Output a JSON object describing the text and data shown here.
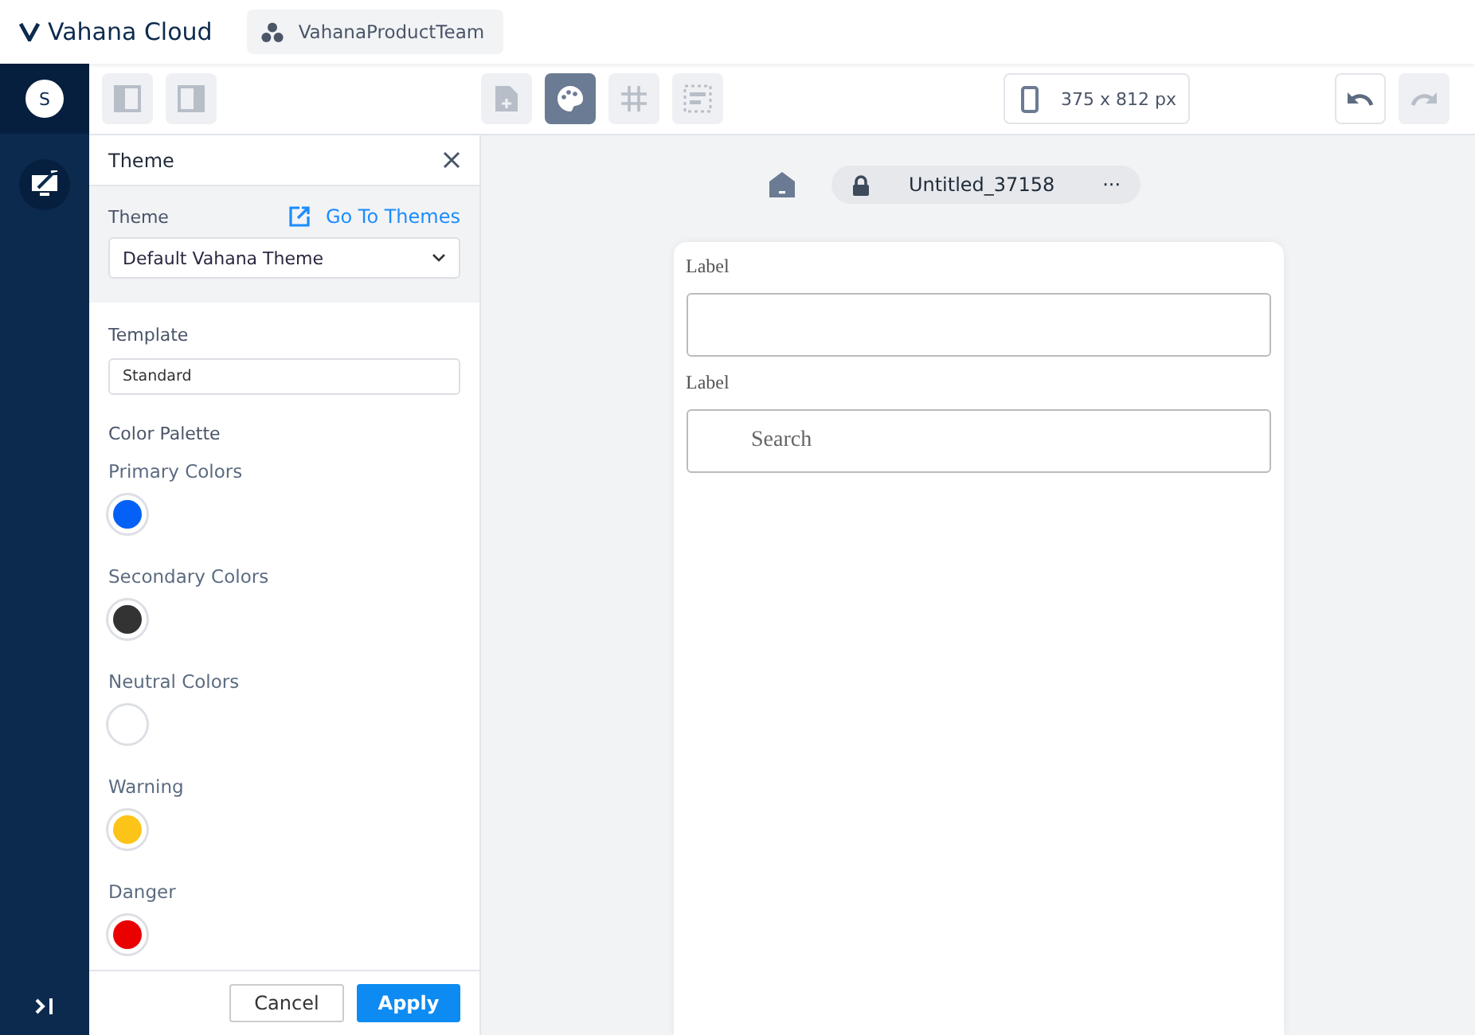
{
  "app": {
    "name": "Vahana Cloud",
    "team": "VahanaProductTeam",
    "avatar": "S"
  },
  "layout_buttons": [
    {
      "kind": "left",
      "selected": false
    },
    {
      "kind": "right",
      "selected": false
    }
  ],
  "tools": [
    {
      "kind": "page",
      "selected": false
    },
    {
      "kind": "palette",
      "selected": true
    },
    {
      "kind": "grid",
      "selected": false
    },
    {
      "kind": "layout",
      "selected": false
    }
  ],
  "device": {
    "size": "375 x 812 px"
  },
  "history": [
    {
      "kind": "undo",
      "disabled": false
    },
    {
      "kind": "redo",
      "disabled": true
    }
  ],
  "panel": {
    "title": "Theme",
    "theme_label": "Theme",
    "go_to_themes": "Go To Themes",
    "theme_value": "Default Vahana Theme",
    "template_label": "Template",
    "template_value": "Standard",
    "palette_label": "Color Palette",
    "colors": [
      {
        "name": "Primary Colors",
        "color": "#0561f5"
      },
      {
        "name": "Secondary Colors",
        "color": "#333333"
      },
      {
        "name": "Neutral Colors",
        "color": "#ffffff"
      },
      {
        "name": "Warning",
        "color": "#fcc419"
      },
      {
        "name": "Danger",
        "color": "#eb0000"
      }
    ],
    "cancel": "Cancel",
    "apply": "Apply"
  },
  "page": {
    "name": "Untitled_37158",
    "more": "···",
    "fields": [
      {
        "label": "Label"
      },
      {
        "label": "Label",
        "placeholder": "Search"
      }
    ]
  }
}
